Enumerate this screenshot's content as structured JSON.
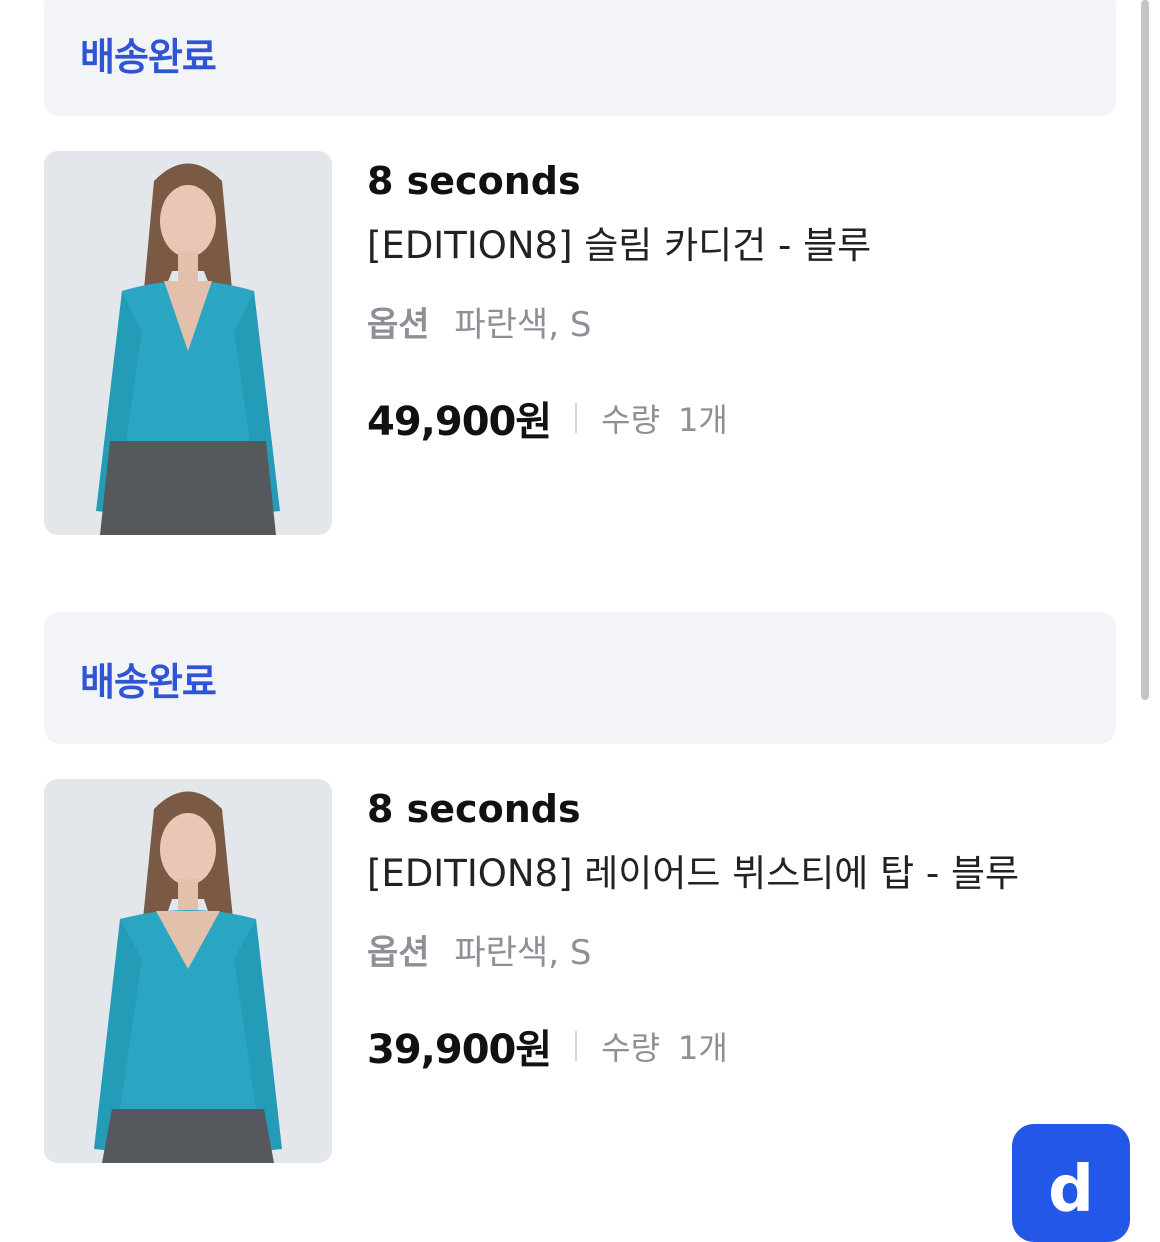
{
  "orders": [
    {
      "status": "배송완료",
      "brand": "8 seconds",
      "title": "[EDITION8] 슬림 카디건 - 블루",
      "option_label": "옵션",
      "option_value": "파란색, S",
      "price": "49,900원",
      "qty_label": "수량",
      "qty_value": "1개"
    },
    {
      "status": "배송완료",
      "brand": "8 seconds",
      "title": "[EDITION8] 레이어드 뷔스티에 탑 - 블루",
      "option_label": "옵션",
      "option_value": "파란색, S",
      "price": "39,900원",
      "qty_label": "수량",
      "qty_value": "1개"
    }
  ],
  "fab": {
    "glyph": "d"
  },
  "colors": {
    "status_text": "#2f55d4",
    "status_bg": "#f2f4f8",
    "fab_bg": "#2357e8",
    "garment": "#2aa6c3"
  }
}
